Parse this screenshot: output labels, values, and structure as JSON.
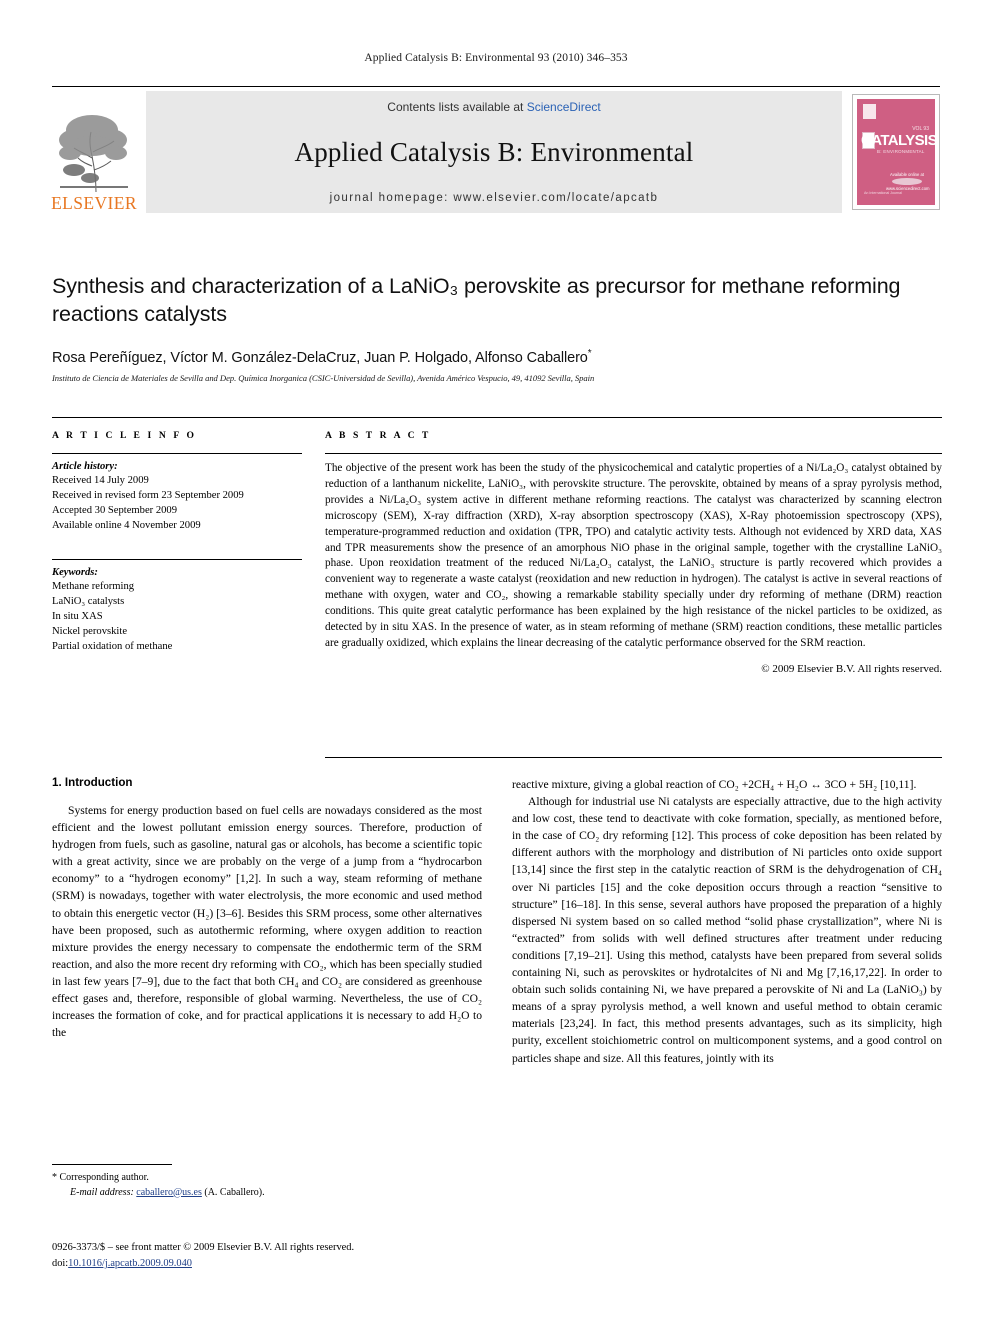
{
  "running_head": "Applied Catalysis B: Environmental 93 (2010) 346–353",
  "masthead": {
    "publisher_name": "ELSEVIER",
    "contents_prefix": "Contents lists available at ",
    "contents_link": "ScienceDirect",
    "journal_title": "Applied Catalysis B: Environmental",
    "homepage_line": "journal homepage: www.elsevier.com/locate/apcatb",
    "cover": {
      "big_title": "CATALYSIS",
      "subtitle": "B: ENVIRONMENTAL",
      "volume": "VOL 93",
      "sciencedirect": "Available online at",
      "sd_name": "ScienceDirect",
      "sd_url": "www.sciencedirect.com",
      "bottom_left": "An International Journal",
      "color": "#cf5f83"
    }
  },
  "article": {
    "title": "Synthesis and characterization of a LaNiO₃ perovskite as precursor for methane reforming reactions catalysts",
    "authors": "Rosa Pereñíguez, Víctor M. González-DelaCruz, Juan P. Holgado, Alfonso Caballero",
    "corresponding_marker": "*",
    "affiliation": "Instituto de Ciencia de Materiales de Sevilla and Dep. Química Inorganica (CSIC-Universidad de Sevilla), Avenida Américo Vespucio, 49, 41092 Sevilla, Spain"
  },
  "article_info": {
    "heading": "A R T I C L E  I N F O",
    "history_label": "Article history:",
    "history": [
      "Received 14 July 2009",
      "Received in revised form 23 September 2009",
      "Accepted 30 September 2009",
      "Available online 4 November 2009"
    ],
    "keywords_label": "Keywords:",
    "keywords": [
      "Methane reforming",
      "LaNiO₃ catalysts",
      "In situ XAS",
      "Nickel perovskite",
      "Partial oxidation of methane"
    ]
  },
  "abstract": {
    "heading": "A B S T R A C T",
    "text": "The objective of the present work has been the study of the physicochemical and catalytic properties of a Ni/La₂O₃ catalyst obtained by reduction of a lanthanum nickelite, LaNiO₃, with perovskite structure. The perovskite, obtained by means of a spray pyrolysis method, provides a Ni/La₂O₃ system active in different methane reforming reactions. The catalyst was characterized by scanning electron microscopy (SEM), X-ray diffraction (XRD), X-ray absorption spectroscopy (XAS), X-Ray photoemission spectroscopy (XPS), temperature-programmed reduction and oxidation (TPR, TPO) and catalytic activity tests. Although not evidenced by XRD data, XAS and TPR measurements show the presence of an amorphous NiO phase in the original sample, together with the crystalline LaNiO₃ phase. Upon reoxidation treatment of the reduced Ni/La₂O₃ catalyst, the LaNiO₃ structure is partly recovered which provides a convenient way to regenerate a waste catalyst (reoxidation and new reduction in hydrogen). The catalyst is active in several reactions of methane with oxygen, water and CO₂, showing a remarkable stability specially under dry reforming of methane (DRM) reaction conditions. This quite great catalytic performance has been explained by the high resistance of the nickel particles to be oxidized, as detected by in situ XAS. In the presence of water, as in steam reforming of methane (SRM) reaction conditions, these metallic particles are gradually oxidized, which explains the linear decreasing of the catalytic performance observed for the SRM reaction.",
    "copyright": "© 2009 Elsevier B.V. All rights reserved."
  },
  "body": {
    "section_title": "1. Introduction",
    "left_paragraph": "Systems for energy production based on fuel cells are nowadays considered as the most efficient and the lowest pollutant emission energy sources. Therefore, production of hydrogen from fuels, such as gasoline, natural gas or alcohols, has become a scientific topic with a great activity, since we are probably on the verge of a jump from a “hydrocarbon economy” to a “hydrogen economy” [1,2]. In such a way, steam reforming of methane (SRM) is nowadays, together with water electrolysis, the more economic and used method to obtain this energetic vector (H₂) [3–6]. Besides this SRM process, some other alternatives have been proposed, such as autothermic reforming, where oxygen addition to reaction mixture provides the energy necessary to compensate the endothermic term of the SRM reaction, and also the more recent dry reforming with CO₂, which has been specially studied in last few years [7–9], due to the fact that both CH₄ and CO₂ are considered as greenhouse effect gases and, therefore, responsible of global warming. Nevertheless, the use of CO₂ increases the formation of coke, and for practical applications it is necessary to add H₂O to the",
    "right_paragraph_1": "reactive mixture, giving a global reaction of CO₂ +2CH₄ + H₂O ↔ 3CO + 5H₂ [10,11].",
    "right_paragraph_2": "Although for industrial use Ni catalysts are especially attractive, due to the high activity and low cost, these tend to deactivate with coke formation, specially, as mentioned before, in the case of CO₂ dry reforming [12]. This process of coke deposition has been related by different authors with the morphology and distribution of Ni particles onto oxide support [13,14] since the first step in the catalytic reaction of SRM is the dehydrogenation of CH₄ over Ni particles [15] and the coke deposition occurs through a reaction “sensitive to structure” [16–18]. In this sense, several authors have proposed the preparation of a highly dispersed Ni system based on so called method “solid phase crystallization”, where Ni is “extracted” from solids with well defined structures after treatment under reducing conditions [7,19–21]. Using this method, catalysts have been prepared from several solids containing Ni, such as perovskites or hydrotalcites of Ni and Mg [7,16,17,22]. In order to obtain such solids containing Ni, we have prepared a perovskite of Ni and La (LaNiO₃) by means of a spray pyrolysis method, a well known and useful method to obtain ceramic materials [23,24]. In fact, this method presents advantages, such as its simplicity, high purity, excellent stoichiometric control on multicomponent systems, and a good control on particles shape and size. All this features, jointly with its"
  },
  "footnote": {
    "corresponding_author": "* Corresponding author.",
    "email_label": "E-mail address:",
    "email": "caballero@us.es",
    "email_suffix": " (A. Caballero)."
  },
  "imprint": {
    "line1": "0926-3373/$ – see front matter © 2009 Elsevier B.V. All rights reserved.",
    "doi_prefix": "doi:",
    "doi": "10.1016/j.apcatb.2009.09.040"
  }
}
